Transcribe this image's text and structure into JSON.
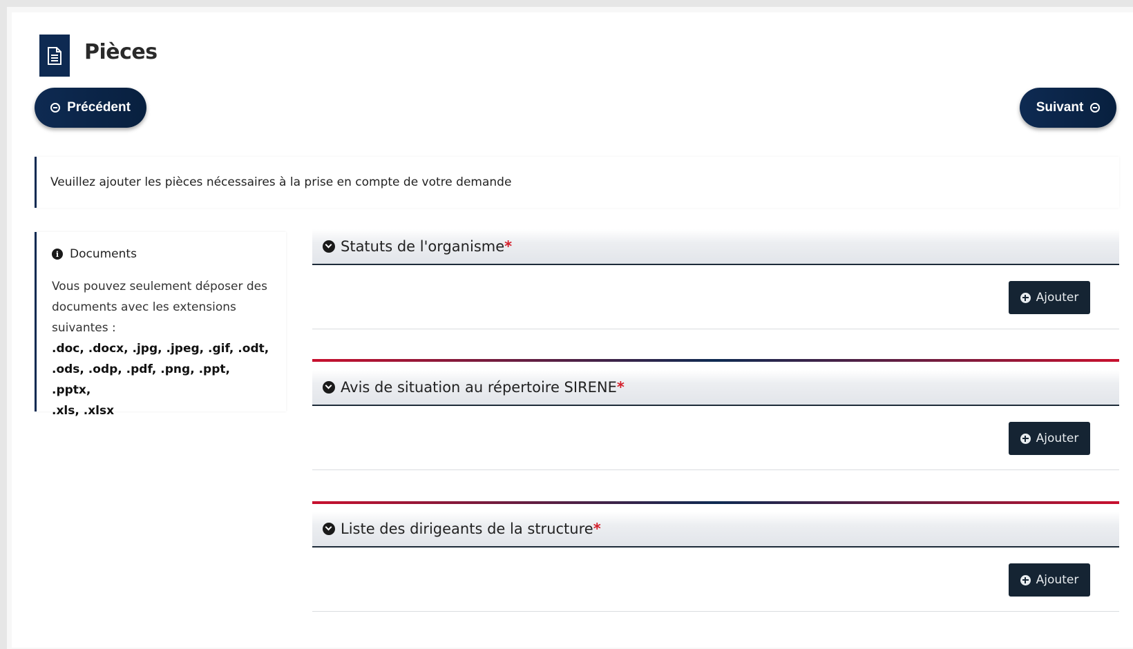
{
  "header": {
    "title": "Pièces",
    "icon": "document-icon"
  },
  "nav": {
    "prev_label": "Précédent",
    "next_label": "Suivant"
  },
  "info_message": "Veuillez ajouter les pièces nécessaires à la prise en compte de votre demande",
  "documents_panel": {
    "title": "Documents",
    "text_1": "Vous pouvez seulement déposer des",
    "text_2": "documents avec les extensions",
    "text_3": "suivantes :",
    "extensions_1": ".doc, .docx, .jpg, .jpeg, .gif, .odt,",
    "extensions_2": ".ods, .odp, .pdf, .png, .ppt, .pptx,",
    "extensions_3": ".xls, .xlsx"
  },
  "sections": [
    {
      "title": "Statuts de l'organisme",
      "required_mark": "*",
      "add_label": "Ajouter"
    },
    {
      "title": "Avis de situation au répertoire SIRENE",
      "required_mark": "*",
      "add_label": "Ajouter"
    },
    {
      "title": "Liste des dirigeants de la structure",
      "required_mark": "*",
      "add_label": "Ajouter"
    }
  ],
  "colors": {
    "primary": "#0e2a52",
    "required": "#d4202c",
    "button_dark": "#152433"
  }
}
